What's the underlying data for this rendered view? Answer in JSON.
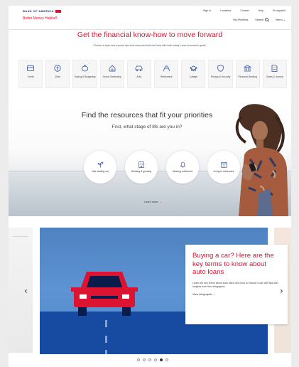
{
  "header": {
    "brand": "BANK OF AMERICA",
    "subbrand": "Better Money Habits®",
    "top_links": [
      "Sign in",
      "Locations",
      "Contact",
      "Help",
      "En español"
    ],
    "nav": {
      "my_priorities": "My Priorities",
      "search": "Search",
      "menu": "Menu"
    }
  },
  "hero": {
    "title": "Get the financial know-how to move forward",
    "subtitle": "Choose a topic and explore tips and resources that can help with both today's and tomorrow's goals."
  },
  "topics": [
    {
      "label": "Credit",
      "icon": "credit-card-icon"
    },
    {
      "label": "Debt",
      "icon": "debt-icon"
    },
    {
      "label": "Saving & Budgeting",
      "icon": "piggy-bank-icon"
    },
    {
      "label": "Home Ownership",
      "icon": "house-icon"
    },
    {
      "label": "Auto",
      "icon": "car-icon"
    },
    {
      "label": "Retirement",
      "icon": "beach-chair-icon"
    },
    {
      "label": "College",
      "icon": "graduation-cap-icon"
    },
    {
      "label": "Privacy & Security",
      "icon": "shield-icon"
    },
    {
      "label": "Personal Banking",
      "icon": "bank-icon"
    },
    {
      "label": "Taxes & Income",
      "icon": "document-icon"
    }
  ],
  "stage": {
    "title": "Find the resources that fit your priorities",
    "subtitle": "First, what stage of life are you in?",
    "options": [
      {
        "label": "Just starting out",
        "icon": "plant-icon"
      },
      {
        "label": "Working & growing",
        "icon": "building-icon"
      },
      {
        "label": "Nearing retirement",
        "icon": "bell-icon"
      },
      {
        "label": "Living in retirement",
        "icon": "calendar-icon"
      }
    ],
    "learn_more": "Learn more"
  },
  "carousel": {
    "card_title": "Buying a car? Here are the key terms to know about auto loans",
    "card_body": "Learn the key terms about auto loans and how to finance a car with tips and insights from this infographic.",
    "card_link": "View infographic",
    "dots": 6,
    "active_dot": 4
  },
  "colors": {
    "brand_red": "#dc1431",
    "brand_navy": "#1f2a5c",
    "slide_blue": "#5e93d3",
    "road_blue": "#174aa1"
  }
}
